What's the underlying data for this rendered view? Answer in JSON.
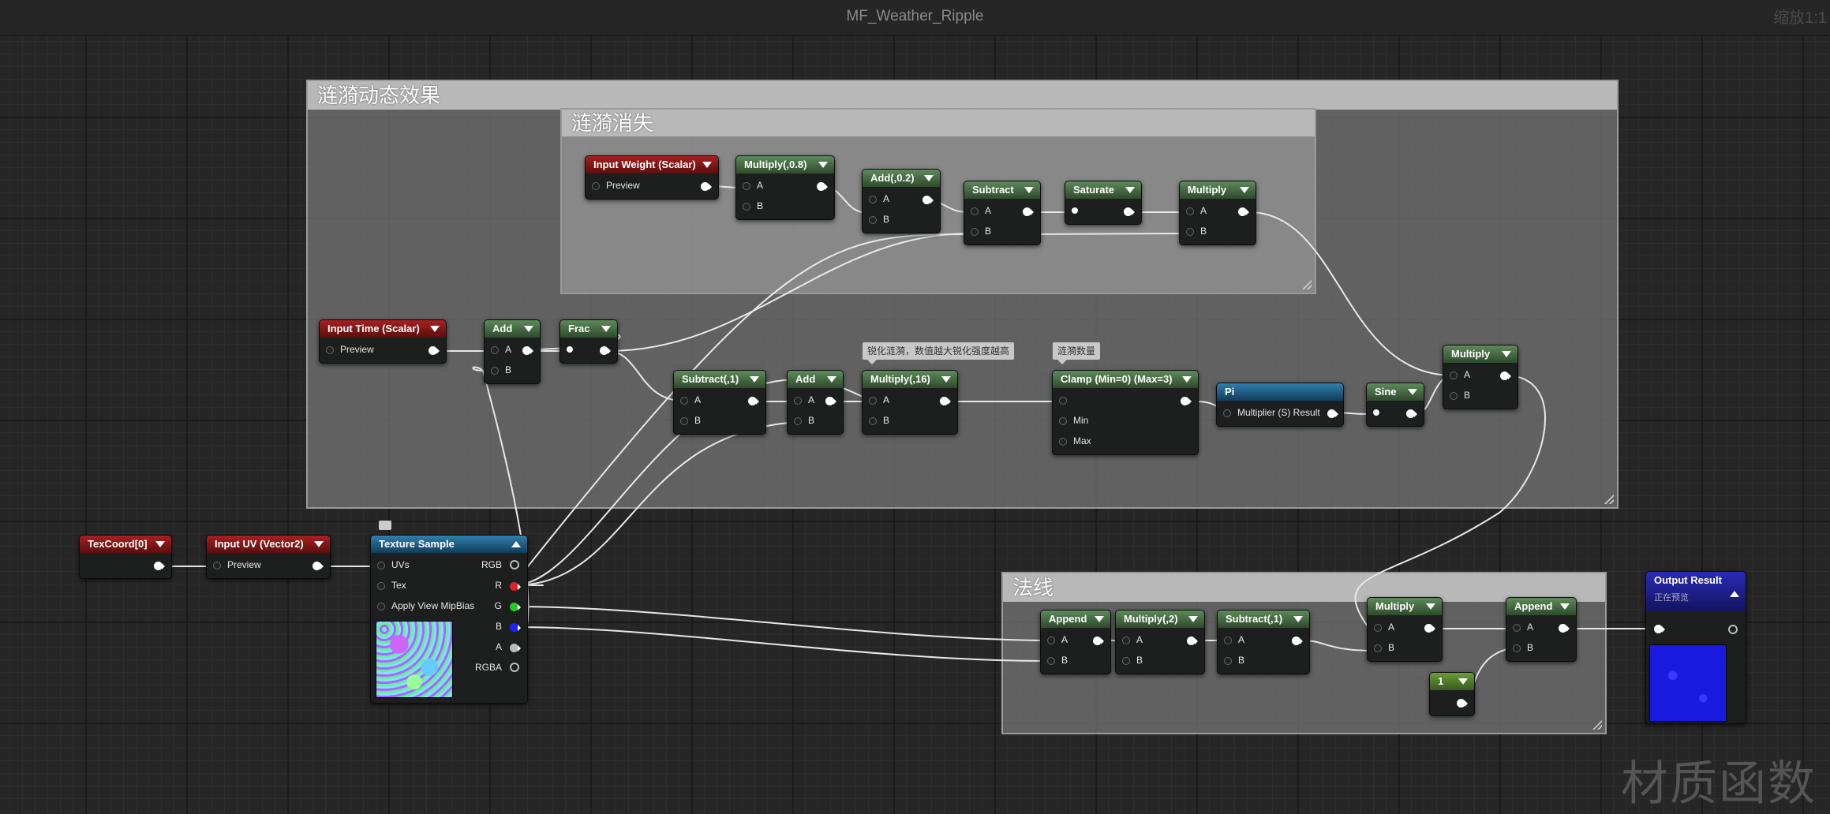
{
  "window": {
    "title": "MF_Weather_Ripple",
    "zoom": "缩放1:1"
  },
  "watermark": "材质函数",
  "comments": {
    "outer": "涟漪动态效果",
    "inner": "涟漪消失",
    "normal": "法线"
  },
  "tooltips": {
    "sharpen": "锐化涟漪，数值越大锐化强度越高",
    "count": "涟漪数量"
  },
  "nodes": {
    "input_weight": {
      "title": "Input Weight (Scalar)",
      "pin": "Preview"
    },
    "multiply_08": {
      "title": "Multiply(,0.8)",
      "a": "A",
      "b": "B"
    },
    "add_02": {
      "title": "Add(,0.2)",
      "a": "A",
      "b": "B"
    },
    "subtract_1": {
      "title": "Subtract",
      "a": "A",
      "b": "B"
    },
    "saturate": {
      "title": "Saturate"
    },
    "multiply_top": {
      "title": "Multiply",
      "a": "A",
      "b": "B"
    },
    "input_time": {
      "title": "Input Time (Scalar)",
      "pin": "Preview"
    },
    "add_time": {
      "title": "Add",
      "a": "A",
      "b": "B"
    },
    "frac": {
      "title": "Frac"
    },
    "subtract_neg1": {
      "title": "Subtract(,1)",
      "a": "A",
      "b": "B"
    },
    "add_mid": {
      "title": "Add",
      "a": "A",
      "b": "B"
    },
    "multiply_16": {
      "title": "Multiply(,16)",
      "a": "A",
      "b": "B"
    },
    "clamp": {
      "title": "Clamp (Min=0) (Max=3)",
      "min": "Min",
      "max": "Max"
    },
    "pi": {
      "title": "Pi",
      "pin": "Multiplier (S) Result"
    },
    "sine": {
      "title": "Sine"
    },
    "multiply_right": {
      "title": "Multiply",
      "a": "A",
      "b": "B"
    },
    "texcoord": {
      "title": "TexCoord[0]"
    },
    "input_uv": {
      "title": "Input UV (Vector2)",
      "pin": "Preview"
    },
    "texture_sample": {
      "title": "Texture Sample",
      "in_uvs": "UVs",
      "in_tex": "Tex",
      "in_mip": "Apply View MipBias",
      "out_rgb": "RGB",
      "out_r": "R",
      "out_g": "G",
      "out_b": "B",
      "out_a": "A",
      "out_rgba": "RGBA"
    },
    "append1": {
      "title": "Append",
      "a": "A",
      "b": "B"
    },
    "multiply_2": {
      "title": "Multiply(,2)",
      "a": "A",
      "b": "B"
    },
    "subtract_n1": {
      "title": "Subtract(,1)",
      "a": "A",
      "b": "B"
    },
    "multiply_n": {
      "title": "Multiply",
      "a": "A",
      "b": "B"
    },
    "append2": {
      "title": "Append",
      "a": "A",
      "b": "B"
    },
    "const1": {
      "title": "1"
    },
    "output": {
      "title": "Output Result",
      "sub": "正在预览"
    }
  },
  "colors": {
    "r_pin": "#e02020",
    "g_pin": "#20d020",
    "b_pin": "#2020ff",
    "output_preview": "#1a1ae0"
  }
}
